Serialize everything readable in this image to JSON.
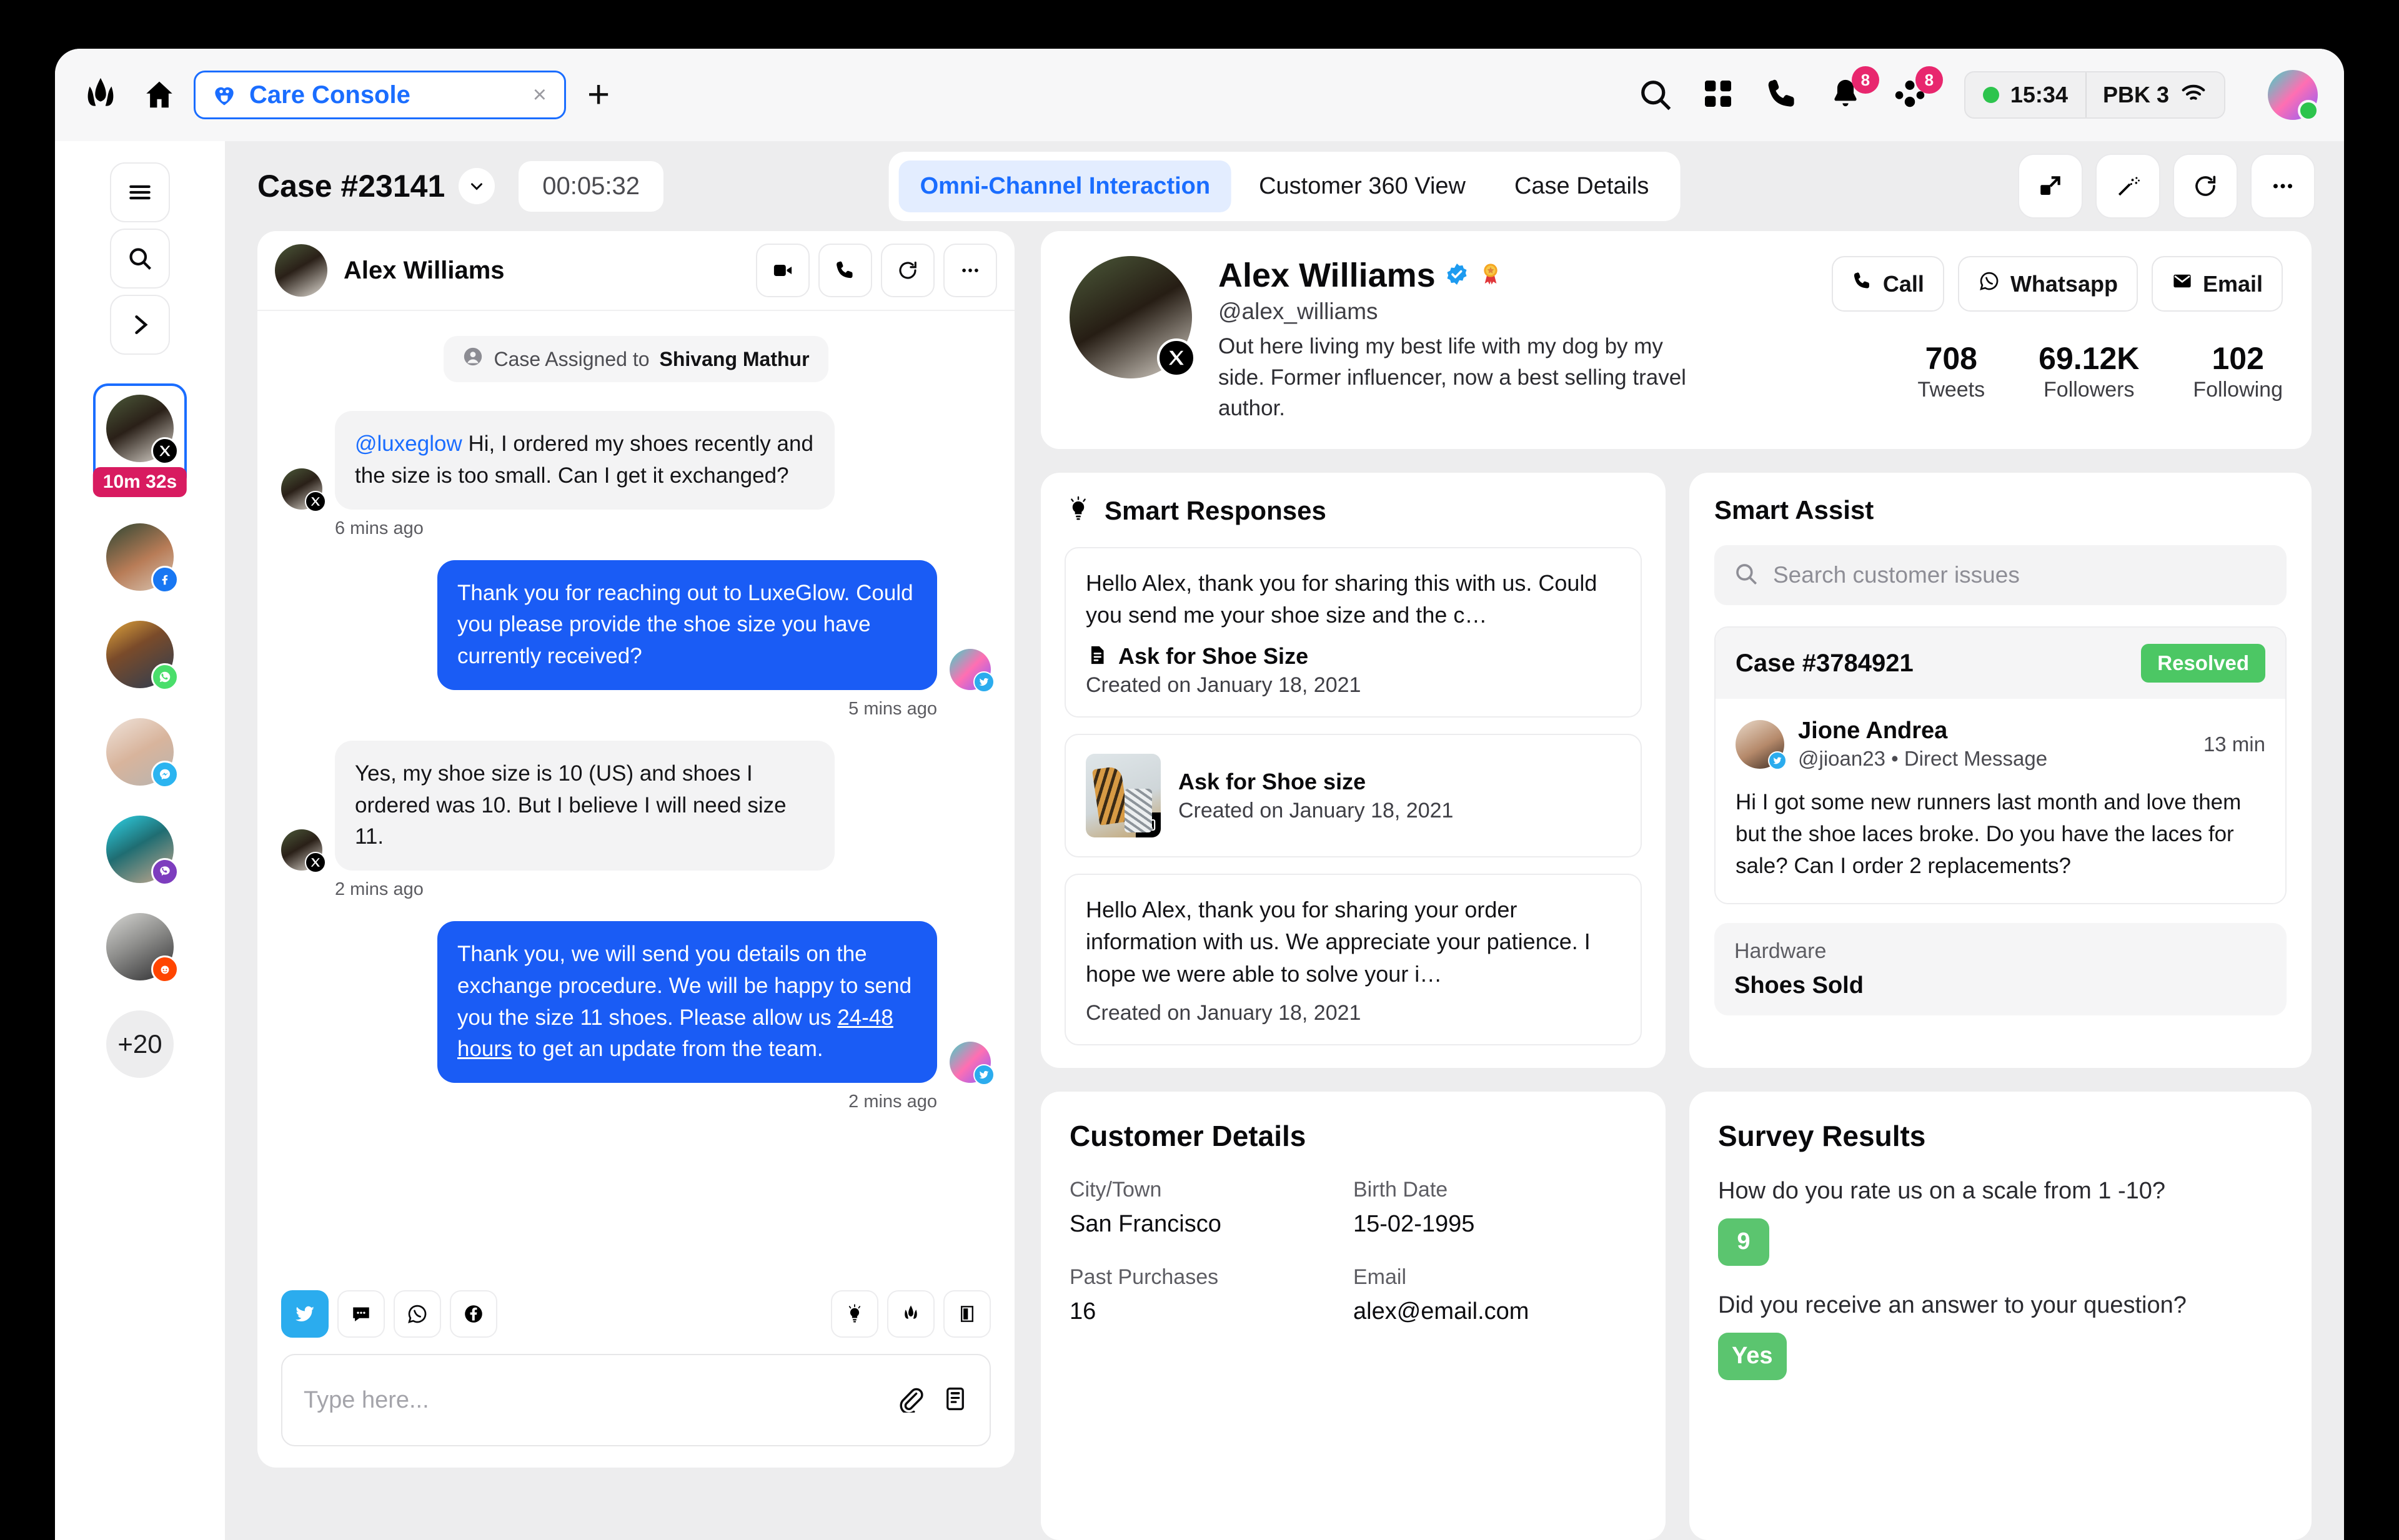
{
  "browser": {
    "logo_icon": "leaf-logo-icon",
    "home_icon": "home-icon",
    "tab": {
      "title": "Care Console",
      "favicon": "care-heart-icon",
      "close": "×"
    },
    "new_tab": "+",
    "icons": {
      "search": "search-icon",
      "apps": "grid-apps-icon",
      "phone": "phone-icon",
      "bell": "bell-icon",
      "people": "people-icon"
    },
    "notification_badge": "8",
    "people_badge": "8",
    "status": {
      "time": "15:34",
      "network": "PBK 3",
      "wifi_icon": "wifi-icon",
      "dot": "online"
    }
  },
  "rail": {
    "menu_icon": "hamburger-menu-icon",
    "search_icon": "search-icon",
    "expand_icon": "chevron-right-icon",
    "conversations": [
      {
        "channel": "x-twitter",
        "timer": "10m 32s",
        "active": true
      },
      {
        "channel": "facebook",
        "active": false
      },
      {
        "channel": "whatsapp",
        "active": false
      },
      {
        "channel": "messenger",
        "active": false
      },
      {
        "channel": "viber",
        "active": false
      },
      {
        "channel": "reddit",
        "active": false
      }
    ],
    "more_label": "+20"
  },
  "workspace": {
    "case_title": "Case #23141",
    "chevron_icon": "chevron-down-icon",
    "timer": "00:05:32",
    "tabs": [
      {
        "label": "Omni-Channel Interaction",
        "active": true
      },
      {
        "label": "Customer 360 View",
        "active": false
      },
      {
        "label": "Case Details",
        "active": false
      }
    ],
    "actions": [
      {
        "name": "transfer-icon"
      },
      {
        "name": "magic-wand-icon"
      },
      {
        "name": "refresh-icon"
      },
      {
        "name": "more-options-icon"
      }
    ]
  },
  "chat": {
    "header": {
      "name": "Alex Williams",
      "buttons": [
        "video-call-icon",
        "phone-icon",
        "refresh-icon",
        "more-options-icon"
      ]
    },
    "system_note": {
      "prefix": "Case Assigned to ",
      "agent": "Shivang Mathur",
      "icon": "user-circle-icon"
    },
    "messages": [
      {
        "direction": "in",
        "mention": "@luxeglow",
        "text": " Hi, I ordered my shoes recently and the size is too small. Can I get it exchanged?",
        "time": "6 mins ago",
        "channel": "x-twitter"
      },
      {
        "direction": "out",
        "text": "Thank you for reaching out to LuxeGlow. Could you please provide the shoe size you have currently received?",
        "time": "5 mins ago",
        "channel": "twitter"
      },
      {
        "direction": "in",
        "text": "Yes, my shoe size is 10 (US) and shoes I ordered was 10. But I believe I will need size 11.",
        "time": "2 mins ago",
        "channel": "x-twitter"
      },
      {
        "direction": "out",
        "text_before": "Thank you, we will send you details on the exchange procedure. We will be happy to send you the size 11 shoes. Please allow us ",
        "text_link": "24-48 hours",
        "text_after": " to get an update from the team.",
        "time": "2 mins ago",
        "channel": "twitter"
      }
    ],
    "channels": [
      {
        "name": "twitter-icon",
        "selected": true
      },
      {
        "name": "sms-icon",
        "selected": false
      },
      {
        "name": "whatsapp-icon",
        "selected": false
      },
      {
        "name": "facebook-icon",
        "selected": false
      }
    ],
    "tools": [
      "lightbulb-icon",
      "leaf-logo-icon",
      "knowledge-icon"
    ],
    "input": {
      "placeholder": "Type here...",
      "attach_icon": "paperclip-icon",
      "template_icon": "template-icon"
    }
  },
  "profile": {
    "name": "Alex Williams",
    "verified_icon": "verified-badge-icon",
    "award_icon": "award-medal-icon",
    "handle": "@alex_williams",
    "bio": "Out here living my best life with my dog by my side. Former influencer, now a best selling travel author.",
    "channel_icon": "x-logo-icon",
    "buttons": [
      {
        "label": "Call",
        "icon": "phone-icon"
      },
      {
        "label": "Whatsapp",
        "icon": "whatsapp-icon"
      },
      {
        "label": "Email",
        "icon": "email-icon"
      }
    ],
    "stats": [
      {
        "value": "708",
        "label": "Tweets"
      },
      {
        "value": "69.12K",
        "label": "Followers"
      },
      {
        "value": "102",
        "label": "Following"
      }
    ]
  },
  "smart_responses": {
    "title": "Smart Responses",
    "icon": "lightbulb-icon",
    "cards": [
      {
        "type": "text",
        "text": "Hello Alex, thank you for sharing this with us. Could you send me your shoe size and the c…",
        "label": "Ask for Shoe Size",
        "label_icon": "document-icon",
        "date": "Created on January 18, 2021"
      },
      {
        "type": "media",
        "label": "Ask for Shoe size",
        "date": "Created on January 18, 2021",
        "media_icon": "image-icon"
      },
      {
        "type": "text",
        "text": "Hello Alex, thank you for sharing your order information with us. We appreciate your patience. I hope we were able to solve your i…",
        "date": "Created on January 18, 2021"
      }
    ]
  },
  "smart_assist": {
    "title": "Smart Assist",
    "search": {
      "placeholder": "Search customer issues",
      "icon": "search-icon"
    },
    "case": {
      "id": "Case #3784921",
      "status": "Resolved",
      "person": {
        "name": "Jione Andrea",
        "handle": "@jioan23",
        "separator": "•",
        "source": "Direct Message",
        "channel": "twitter"
      },
      "time": "13 min",
      "message": "Hi I got some new runners last month and love them but the shoe laces broke. Do you have the laces for sale? Can I order 2 replacements?",
      "hardware_label": "Hardware",
      "hardware_value": "Shoes Sold"
    }
  },
  "customer_details": {
    "title": "Customer Details",
    "fields": [
      {
        "label": "City/Town",
        "value": "San Francisco"
      },
      {
        "label": "Birth Date",
        "value": "15-02-1995"
      },
      {
        "label": "Past Purchases",
        "value": "16"
      },
      {
        "label": "Email",
        "value": "alex@email.com"
      }
    ]
  },
  "survey": {
    "title": "Survey Results",
    "items": [
      {
        "question": "How do you rate us on a scale from 1 -10?",
        "answer": "9"
      },
      {
        "question": "Did you receive an answer to your question?",
        "answer": "Yes"
      }
    ]
  },
  "colors": {
    "accent_blue": "#1a6dff",
    "bubble_blue": "#1a5cf5",
    "badge_pink": "#e8276e",
    "success_green": "#4cc764",
    "timer_pink": "#d81b60"
  }
}
